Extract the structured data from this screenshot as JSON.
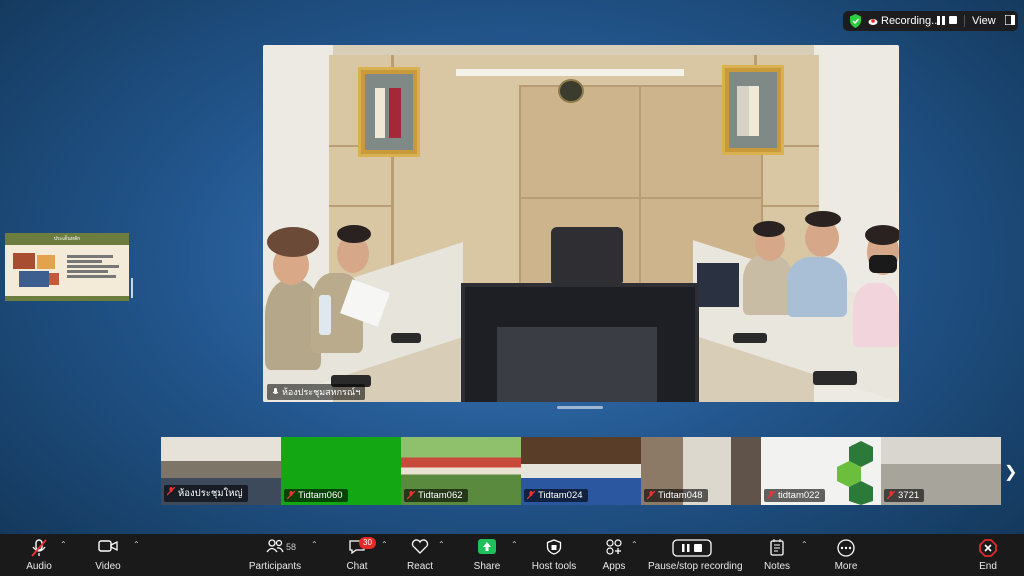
{
  "status": {
    "recording_label": "Recording...",
    "view_label": "View"
  },
  "main_video": {
    "name": "ห้องประชุมสหกรณ์ฯ"
  },
  "shared_thumb": {
    "title": "ประเด็นหลัก"
  },
  "gallery": [
    {
      "name": "ห้องประชุมใหญ่",
      "bg": "#7c7a72"
    },
    {
      "name": "Tidtam060",
      "bg": "#13a813"
    },
    {
      "name": "Tidtam062",
      "bg": "#3f7a3a"
    },
    {
      "name": "Tidtam024",
      "bg": "#4e3a2a"
    },
    {
      "name": "Tidtam048",
      "bg": "#6b5b50"
    },
    {
      "name": "tidtam022",
      "bg": "#f2f2f0"
    },
    {
      "name": "3721",
      "bg": "#bfbdb6"
    }
  ],
  "toolbar": {
    "audio": "Audio",
    "video": "Video",
    "participants": "Participants",
    "participants_count": "58",
    "chat": "Chat",
    "chat_badge": "30",
    "react": "React",
    "share": "Share",
    "host_tools": "Host tools",
    "apps": "Apps",
    "recording": "Pause/stop recording",
    "notes": "Notes",
    "more": "More",
    "end": "End"
  },
  "colors": {
    "share_green": "#1fbf5b",
    "end_red": "#e02b2b",
    "shield_green": "#2ecc40"
  }
}
